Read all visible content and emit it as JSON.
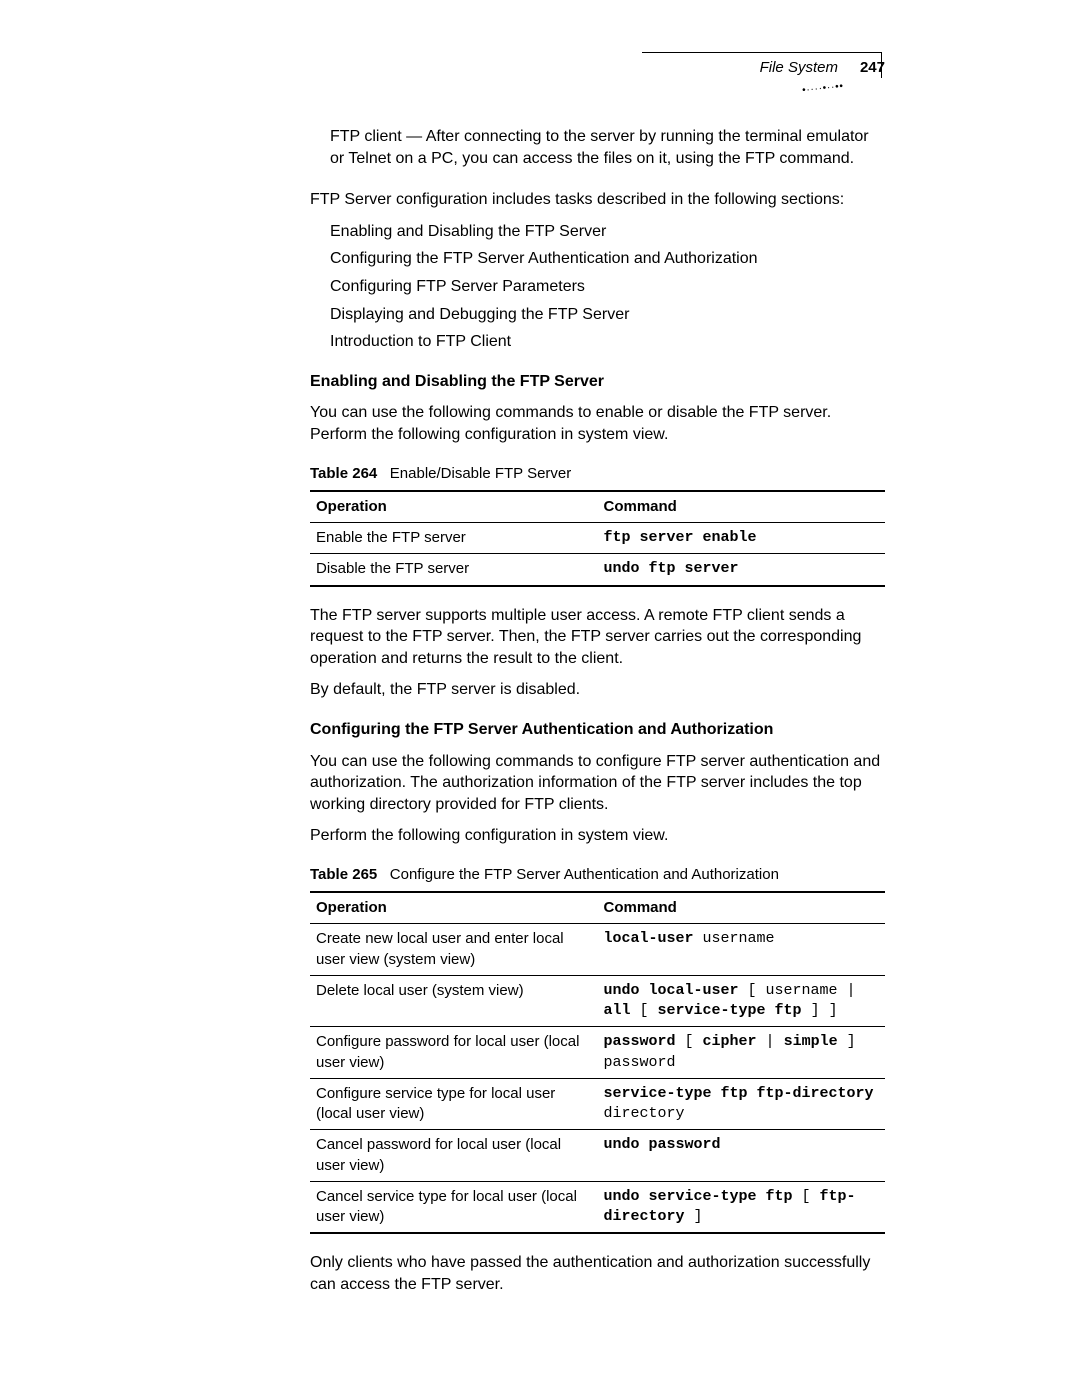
{
  "header": {
    "section": "File System",
    "pagenum": "247"
  },
  "body": {
    "p1": "FTP client — After connecting to the server by running the terminal emulator or Telnet on a PC, you can access the files on it, using the FTP command.",
    "p2": "FTP Server configuration includes tasks described in the following sections:",
    "list1": [
      "Enabling and Disabling the FTP Server",
      "Configuring the FTP Server Authentication and Authorization",
      "Configuring FTP Server Parameters",
      "Displaying and Debugging the FTP Server",
      "Introduction to FTP Client"
    ],
    "h1": "Enabling and Disabling the FTP Server",
    "p3": "You can use the following commands to enable or disable the FTP server. Perform the following configuration in system view.",
    "table264": {
      "label": "Table 264",
      "title": "Enable/Disable FTP Server",
      "headers": {
        "op": "Operation",
        "cmd": "Command"
      },
      "rows": [
        {
          "op": "Enable the FTP server",
          "cmd_kw": "ftp server enable",
          "cmd_rest": ""
        },
        {
          "op": "Disable the FTP server",
          "cmd_kw": "undo ftp server",
          "cmd_rest": ""
        }
      ]
    },
    "p4": "The FTP server supports multiple user access. A remote FTP client sends a request to the FTP server. Then, the FTP server carries out the corresponding operation and returns the result to the client.",
    "p5": "By default, the FTP server is disabled.",
    "h2": "Configuring the FTP Server Authentication and Authorization",
    "p6": "You can use the following commands to configure FTP server authentication and authorization. The authorization information of the FTP server includes the top working directory provided for FTP clients.",
    "p7": "Perform the following configuration in system view.",
    "table265": {
      "label": "Table 265",
      "title": "Configure the FTP Server Authentication and Authorization",
      "headers": {
        "op": "Operation",
        "cmd": "Command"
      },
      "rows": [
        {
          "op": "Create new local user and enter local user view (system view)",
          "cmd_parts": [
            "local-user",
            " username"
          ]
        },
        {
          "op": "Delete local user (system view)",
          "cmd_parts": [
            "undo local-user",
            " [ username | ",
            "all",
            " [ ",
            "service-type ftp",
            " ] ]"
          ]
        },
        {
          "op": "Configure password for local user (local user view)",
          "cmd_parts": [
            "password",
            " [ ",
            "cipher",
            " | ",
            "simple",
            " ] password"
          ]
        },
        {
          "op": "Configure service type for local user (local user view)",
          "cmd_parts": [
            "service-type ftp ftp-directory",
            " directory"
          ]
        },
        {
          "op": "Cancel password for local user (local user view)",
          "cmd_parts": [
            "undo password",
            ""
          ]
        },
        {
          "op": "Cancel service type for local user (local user view)",
          "cmd_parts": [
            "undo service-type ftp",
            " [ ",
            "ftp-directory",
            " ]"
          ]
        }
      ]
    },
    "p8": "Only clients who have passed the authentication and authorization successfully can access the FTP server."
  }
}
